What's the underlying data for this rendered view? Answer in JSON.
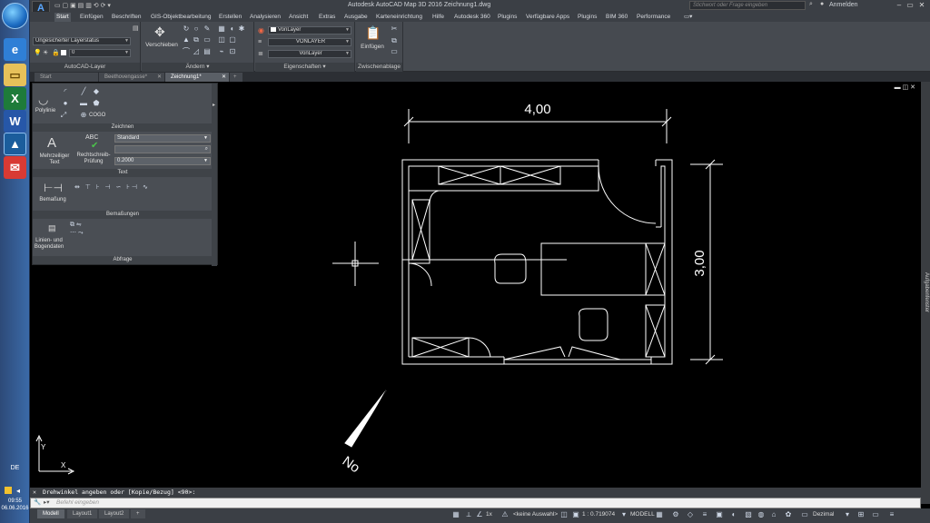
{
  "taskbar": {
    "language": "DE",
    "time": "09:55",
    "date": "06.06.2016",
    "apps": [
      "internet-explorer",
      "file-explorer",
      "excel",
      "word",
      "autocad",
      "mail"
    ]
  },
  "titlebar": {
    "title": "Autodesk AutoCAD Map 3D 2016   Zeichnung1.dwg",
    "search_placeholder": "Stichwort oder Frage eingeben",
    "login": "Anmelden",
    "app_logo": "A"
  },
  "ribbon_tabs": [
    "Start",
    "Einfügen",
    "Beschriften",
    "GIS-Objektbearbeitung",
    "Erstellen",
    "Analysieren",
    "Ansicht",
    "Extras",
    "Ausgabe",
    "Karteneinrichtung",
    "Hilfe",
    "Autodesk 360",
    "Plugins",
    "Verfügbare Apps",
    "Plugins",
    "BIM 360",
    "Performance"
  ],
  "ribbon": {
    "layer_status": "Ungesicherter Layerstatus",
    "layer_current": "0",
    "layer_panel_title": "AutoCAD-Layer",
    "move_label": "Verschieben",
    "modify_panel_title": "Ändern",
    "color_value": "VonLayer",
    "linetype_value": "VONLAYER",
    "lineweight_value": "VonLayer",
    "properties_panel_title": "Eigenschaften",
    "paste_label": "Einfügen",
    "clipboard_panel_title": "Zwischenablage"
  },
  "file_tabs": [
    "Start",
    "Beethovengasse*",
    "Zeichnung1*"
  ],
  "float_panel": {
    "draw_title": "Zeichnen",
    "polyline": "Polylinie",
    "cogo": "COGO",
    "mtext_label": "Mehrzeiliger Text",
    "spell_label": "Rechtschreib-Prüfung",
    "text_style": "Standard",
    "text_height": "0.2000",
    "text_title": "Text",
    "dim_label": "Bemaßung",
    "dim_title": "Bemaßungen",
    "query_label": "Linien- und Bogendaten",
    "query_title": "Abfrage",
    "abc": "ABC",
    "big_a": "A"
  },
  "drawing": {
    "width_dim": "4,00",
    "height_dim": "3,00",
    "north_label": "No"
  },
  "command": {
    "history": "Drehwinkel angeben oder [Kopie/Bezug] <90>:",
    "input_placeholder": "Befehl eingeben"
  },
  "right_palette": "Aufgabenfenster",
  "status": {
    "layouts": [
      "Modell",
      "Layout1",
      "Layout2"
    ],
    "scale_1x": "1x",
    "selection": "<keine Auswahl>",
    "scale": "1 : 0.719074",
    "model": "MODELL",
    "units": "Dezimal"
  },
  "colors": {
    "background": "#000000",
    "chrome": "#3b3f45",
    "ribbon": "#464a50",
    "accent": "#5aa7ff"
  }
}
